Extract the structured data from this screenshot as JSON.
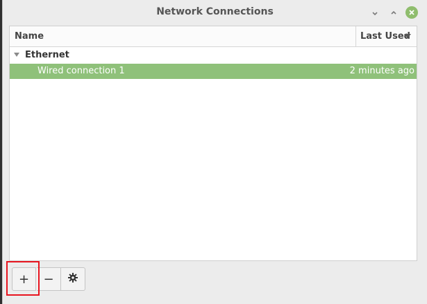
{
  "window": {
    "title": "Network Connections",
    "close_color": "#8fbd6d"
  },
  "window_controls": {
    "minimize_icon": "minimize-icon",
    "maximize_icon": "maximize-icon",
    "close_icon": "close-icon"
  },
  "list": {
    "columns": [
      "Name",
      "Last Used"
    ],
    "sort_icon": "sort-descending-icon",
    "groups": [
      {
        "label": "Ethernet",
        "expanded": true,
        "connections": [
          {
            "name": "Wired connection 1",
            "last_used": "2 minutes ago",
            "selected": true
          }
        ]
      }
    ],
    "selection_color": "#8fc17a"
  },
  "toolbar": {
    "add_label": "+",
    "remove_label": "−",
    "settings_icon": "gear-icon"
  },
  "annotation": {
    "highlight_color": "#e8141e"
  }
}
